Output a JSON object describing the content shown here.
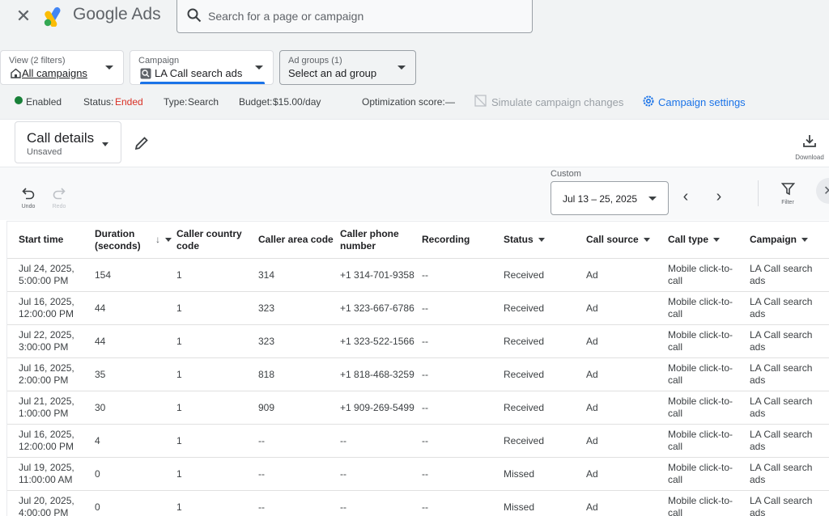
{
  "app": {
    "brand_google": "Google",
    "brand_ads": "Ads"
  },
  "search": {
    "placeholder": "Search for a page or campaign"
  },
  "filters": {
    "view_label": "View (2 filters)",
    "view_value": "All campaigns",
    "campaign_label": "Campaign",
    "campaign_value": "LA Call search ads",
    "adgroup_label": "Ad groups (1)",
    "adgroup_value": "Select an ad group"
  },
  "status_bar": {
    "enabled": "Enabled",
    "status_label": "Status:",
    "status_value": "Ended",
    "type_label": "Type:",
    "type_value": "Search",
    "budget_label": "Budget:",
    "budget_value": "$15.00/day",
    "optimization_label": "Optimization score:",
    "optimization_value": "—",
    "simulate": "Simulate campaign changes",
    "settings": "Campaign settings"
  },
  "report": {
    "title": "Call details",
    "subtitle": "Unsaved",
    "download": "Download",
    "undo": "Undo",
    "redo": "Redo",
    "custom_label": "Custom",
    "date_range": "Jul 13 – 25, 2025",
    "filter": "Filter"
  },
  "table": {
    "columns": [
      "Start time",
      "Duration (seconds)",
      "Caller country code",
      "Caller area code",
      "Caller phone number",
      "Recording",
      "Status",
      "Call source",
      "Call type",
      "Campaign"
    ],
    "rows": [
      [
        "Jul 24, 2025, 5:00:00 PM",
        "154",
        "1",
        "314",
        "+1 314-701-9358",
        "--",
        "Received",
        "Ad",
        "Mobile click-to-call",
        "LA Call search ads"
      ],
      [
        "Jul 16, 2025, 12:00:00 PM",
        "44",
        "1",
        "323",
        "+1 323-667-6786",
        "--",
        "Received",
        "Ad",
        "Mobile click-to-call",
        "LA Call search ads"
      ],
      [
        "Jul 22, 2025, 3:00:00 PM",
        "44",
        "1",
        "323",
        "+1 323-522-1566",
        "--",
        "Received",
        "Ad",
        "Mobile click-to-call",
        "LA Call search ads"
      ],
      [
        "Jul 16, 2025, 2:00:00 PM",
        "35",
        "1",
        "818",
        "+1 818-468-3259",
        "--",
        "Received",
        "Ad",
        "Mobile click-to-call",
        "LA Call search ads"
      ],
      [
        "Jul 21, 2025, 1:00:00 PM",
        "30",
        "1",
        "909",
        "+1 909-269-5499",
        "--",
        "Received",
        "Ad",
        "Mobile click-to-call",
        "LA Call search ads"
      ],
      [
        "Jul 16, 2025, 12:00:00 PM",
        "4",
        "1",
        "--",
        "--",
        "--",
        "Received",
        "Ad",
        "Mobile click-to-call",
        "LA Call search ads"
      ],
      [
        "Jul 19, 2025, 11:00:00 AM",
        "0",
        "1",
        "--",
        "--",
        "--",
        "Missed",
        "Ad",
        "Mobile click-to-call",
        "LA Call search ads"
      ],
      [
        "Jul 20, 2025, 4:00:00 PM",
        "0",
        "1",
        "--",
        "--",
        "--",
        "Missed",
        "Ad",
        "Mobile click-to-call",
        "LA Call search ads"
      ]
    ]
  }
}
